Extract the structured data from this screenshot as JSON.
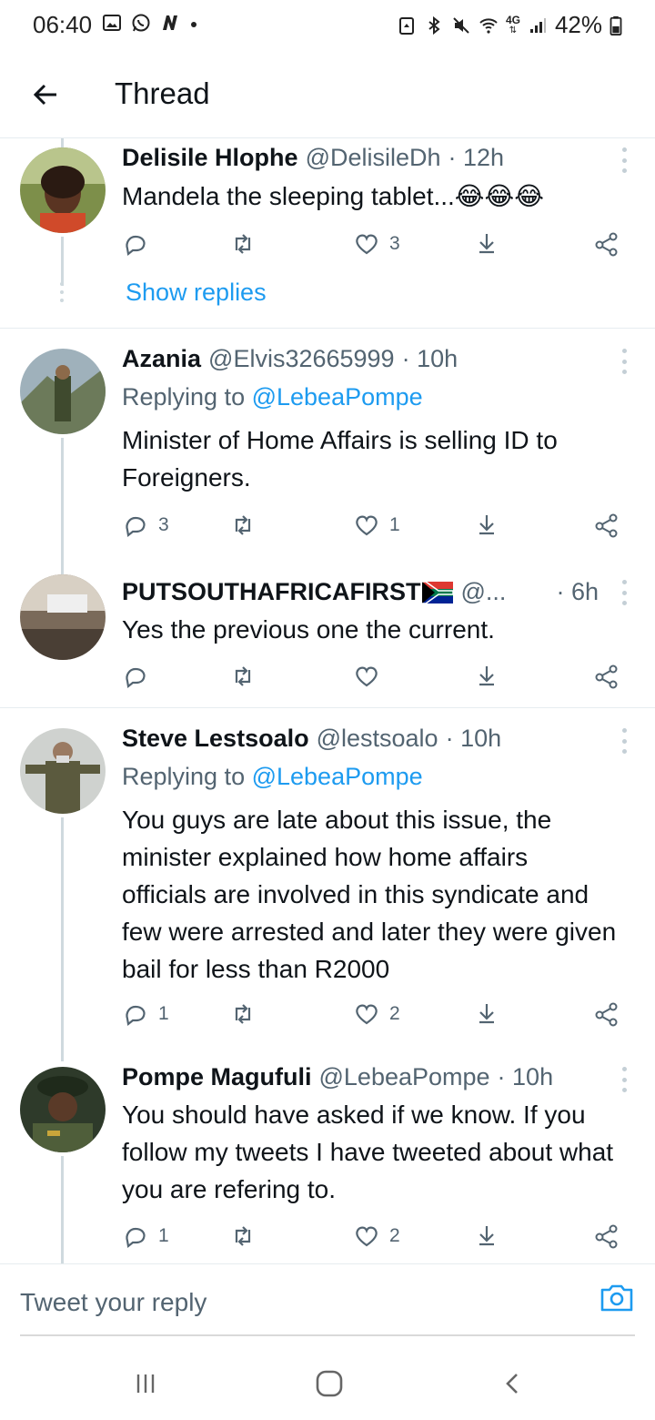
{
  "status_bar": {
    "time": "06:40",
    "network": "4G",
    "battery": "42%",
    "icons_left": [
      "gallery-icon",
      "whatsapp-icon",
      "n-icon",
      "dot-icon"
    ],
    "icons_right": [
      "vpn-icon",
      "bluetooth-icon",
      "mute-icon",
      "wifi-icon",
      "signal-icon",
      "battery-icon"
    ]
  },
  "header": {
    "title": "Thread"
  },
  "tweets": [
    {
      "name": "Delisile Hlophe",
      "handle": "@DelisileDh",
      "time": "· 12h",
      "text": "Mandela the sleeping tablet...😂😂😂",
      "replies": "",
      "likes": "3",
      "show_replies": "Show replies"
    },
    {
      "name": "Azania",
      "handle": "@Elvis32665999",
      "time": "· 10h",
      "replying_prefix": "Replying to ",
      "replying_to": "@LebeaPompe",
      "text": "Minister of Home Affairs is selling ID to Foreigners.",
      "replies": "3",
      "likes": "1"
    },
    {
      "name": "PUTSOUTHAFRICAFIRST",
      "handle": "@...",
      "time": "· 6h",
      "text": "Yes the previous one the current.",
      "replies": "",
      "likes": ""
    },
    {
      "name": "Steve Lestsoalo",
      "handle": "@lestsoalo",
      "time": "· 10h",
      "replying_prefix": "Replying to ",
      "replying_to": "@LebeaPompe",
      "text": "You guys are late about this issue, the minister explained how home affairs officials are involved in this syndicate and few were arrested and later they were given bail for less than R2000",
      "replies": "1",
      "likes": "2"
    },
    {
      "name": "Pompe Magufuli",
      "handle": "@LebeaPompe",
      "time": "· 10h",
      "text": "You should  have asked if we know.  If you follow my tweets I have tweeted about what you are refering to.",
      "replies": "1",
      "likes": "2"
    }
  ],
  "reply_bar": {
    "placeholder": "Tweet your reply"
  },
  "colors": {
    "accent": "#1d9bf0",
    "muted": "#536471",
    "text": "#0f1419",
    "divider": "#e6ecf0"
  }
}
